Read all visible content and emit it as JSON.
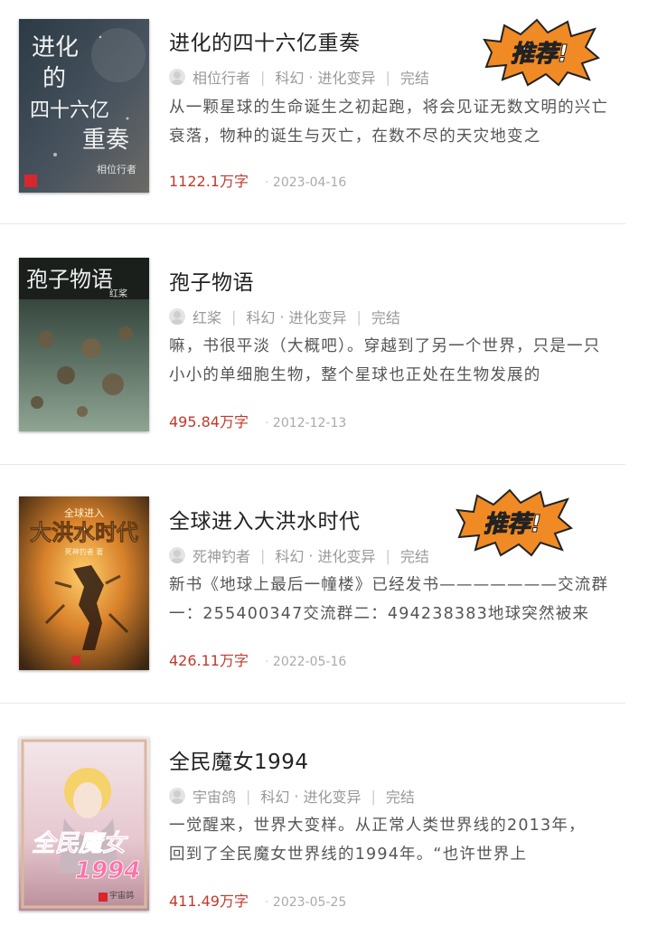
{
  "books": [
    {
      "title": "进化的四十六亿重奏",
      "author": "相位行者",
      "category": "科幻",
      "subcategory": "进化变异",
      "status": "完结",
      "description": "从一颗星球的生命诞生之初起跑，将会见证无数文明的兴亡衰落，物种的诞生与灭亡，在数不尽的天灾地变之",
      "word_count": "1122.1万字",
      "date": "2023-04-16",
      "recommended": true,
      "cover_text": [
        "进化",
        "的",
        "四十六亿",
        "重奏",
        "相位行者"
      ]
    },
    {
      "title": "孢子物语",
      "author": "红桨",
      "category": "科幻",
      "subcategory": "进化变异",
      "status": "完结",
      "description": "嘛，书很平淡（大概吧）。穿越到了另一个世界，只是一只小小的单细胞生物，整个星球也正处在生物发展的",
      "word_count": "495.84万字",
      "date": "2012-12-13",
      "recommended": false,
      "cover_text": [
        "孢子物语",
        "红桨"
      ]
    },
    {
      "title": "全球进入大洪水时代",
      "author": "死神钓者",
      "category": "科幻",
      "subcategory": "进化变异",
      "status": "完结",
      "description": "新书《地球上最后一幢楼》已经发书———————交流群一：255400347交流群二：494238383地球突然被来",
      "word_count": "426.11万字",
      "date": "2022-05-16",
      "recommended": true,
      "cover_text": [
        "全球进入",
        "大洪水时代",
        "死神钓者 著"
      ]
    },
    {
      "title": "全民魔女1994",
      "author": "宇宙鸽",
      "category": "科幻",
      "subcategory": "进化变异",
      "status": "完结",
      "description": "一觉醒来，世界大变样。从正常人类世界线的2013年，回到了全民魔女世界线的1994年。“也许世界上",
      "word_count": "411.49万字",
      "date": "2023-05-25",
      "recommended": false,
      "cover_text": [
        "全民魔女",
        "1994",
        "宇宙鸽"
      ]
    }
  ],
  "badge_label": "推荐!",
  "colors": {
    "word_count": "#c0392b",
    "badge_fill": "#f08a24",
    "badge_text": "#ffffff",
    "divider": "#e6e6e6"
  }
}
